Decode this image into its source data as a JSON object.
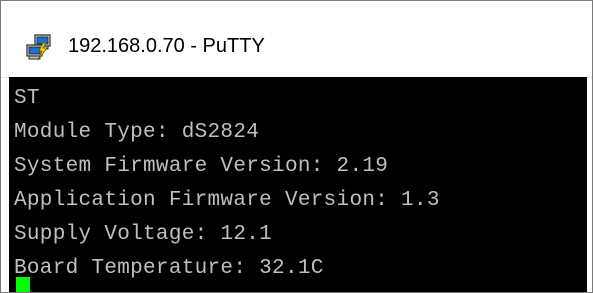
{
  "window": {
    "title": "192.168.0.70 - PuTTY",
    "app_icon": "putty-icon"
  },
  "terminal": {
    "lines": [
      "ST",
      "Module Type: dS2824",
      "System Firmware Version: 2.19",
      "Application Firmware Version: 1.3",
      "Supply Voltage: 12.1",
      "Board Temperature: 32.1C"
    ],
    "background_color": "#000000",
    "text_color": "#bfbfbf",
    "cursor_color": "#00ff00"
  }
}
